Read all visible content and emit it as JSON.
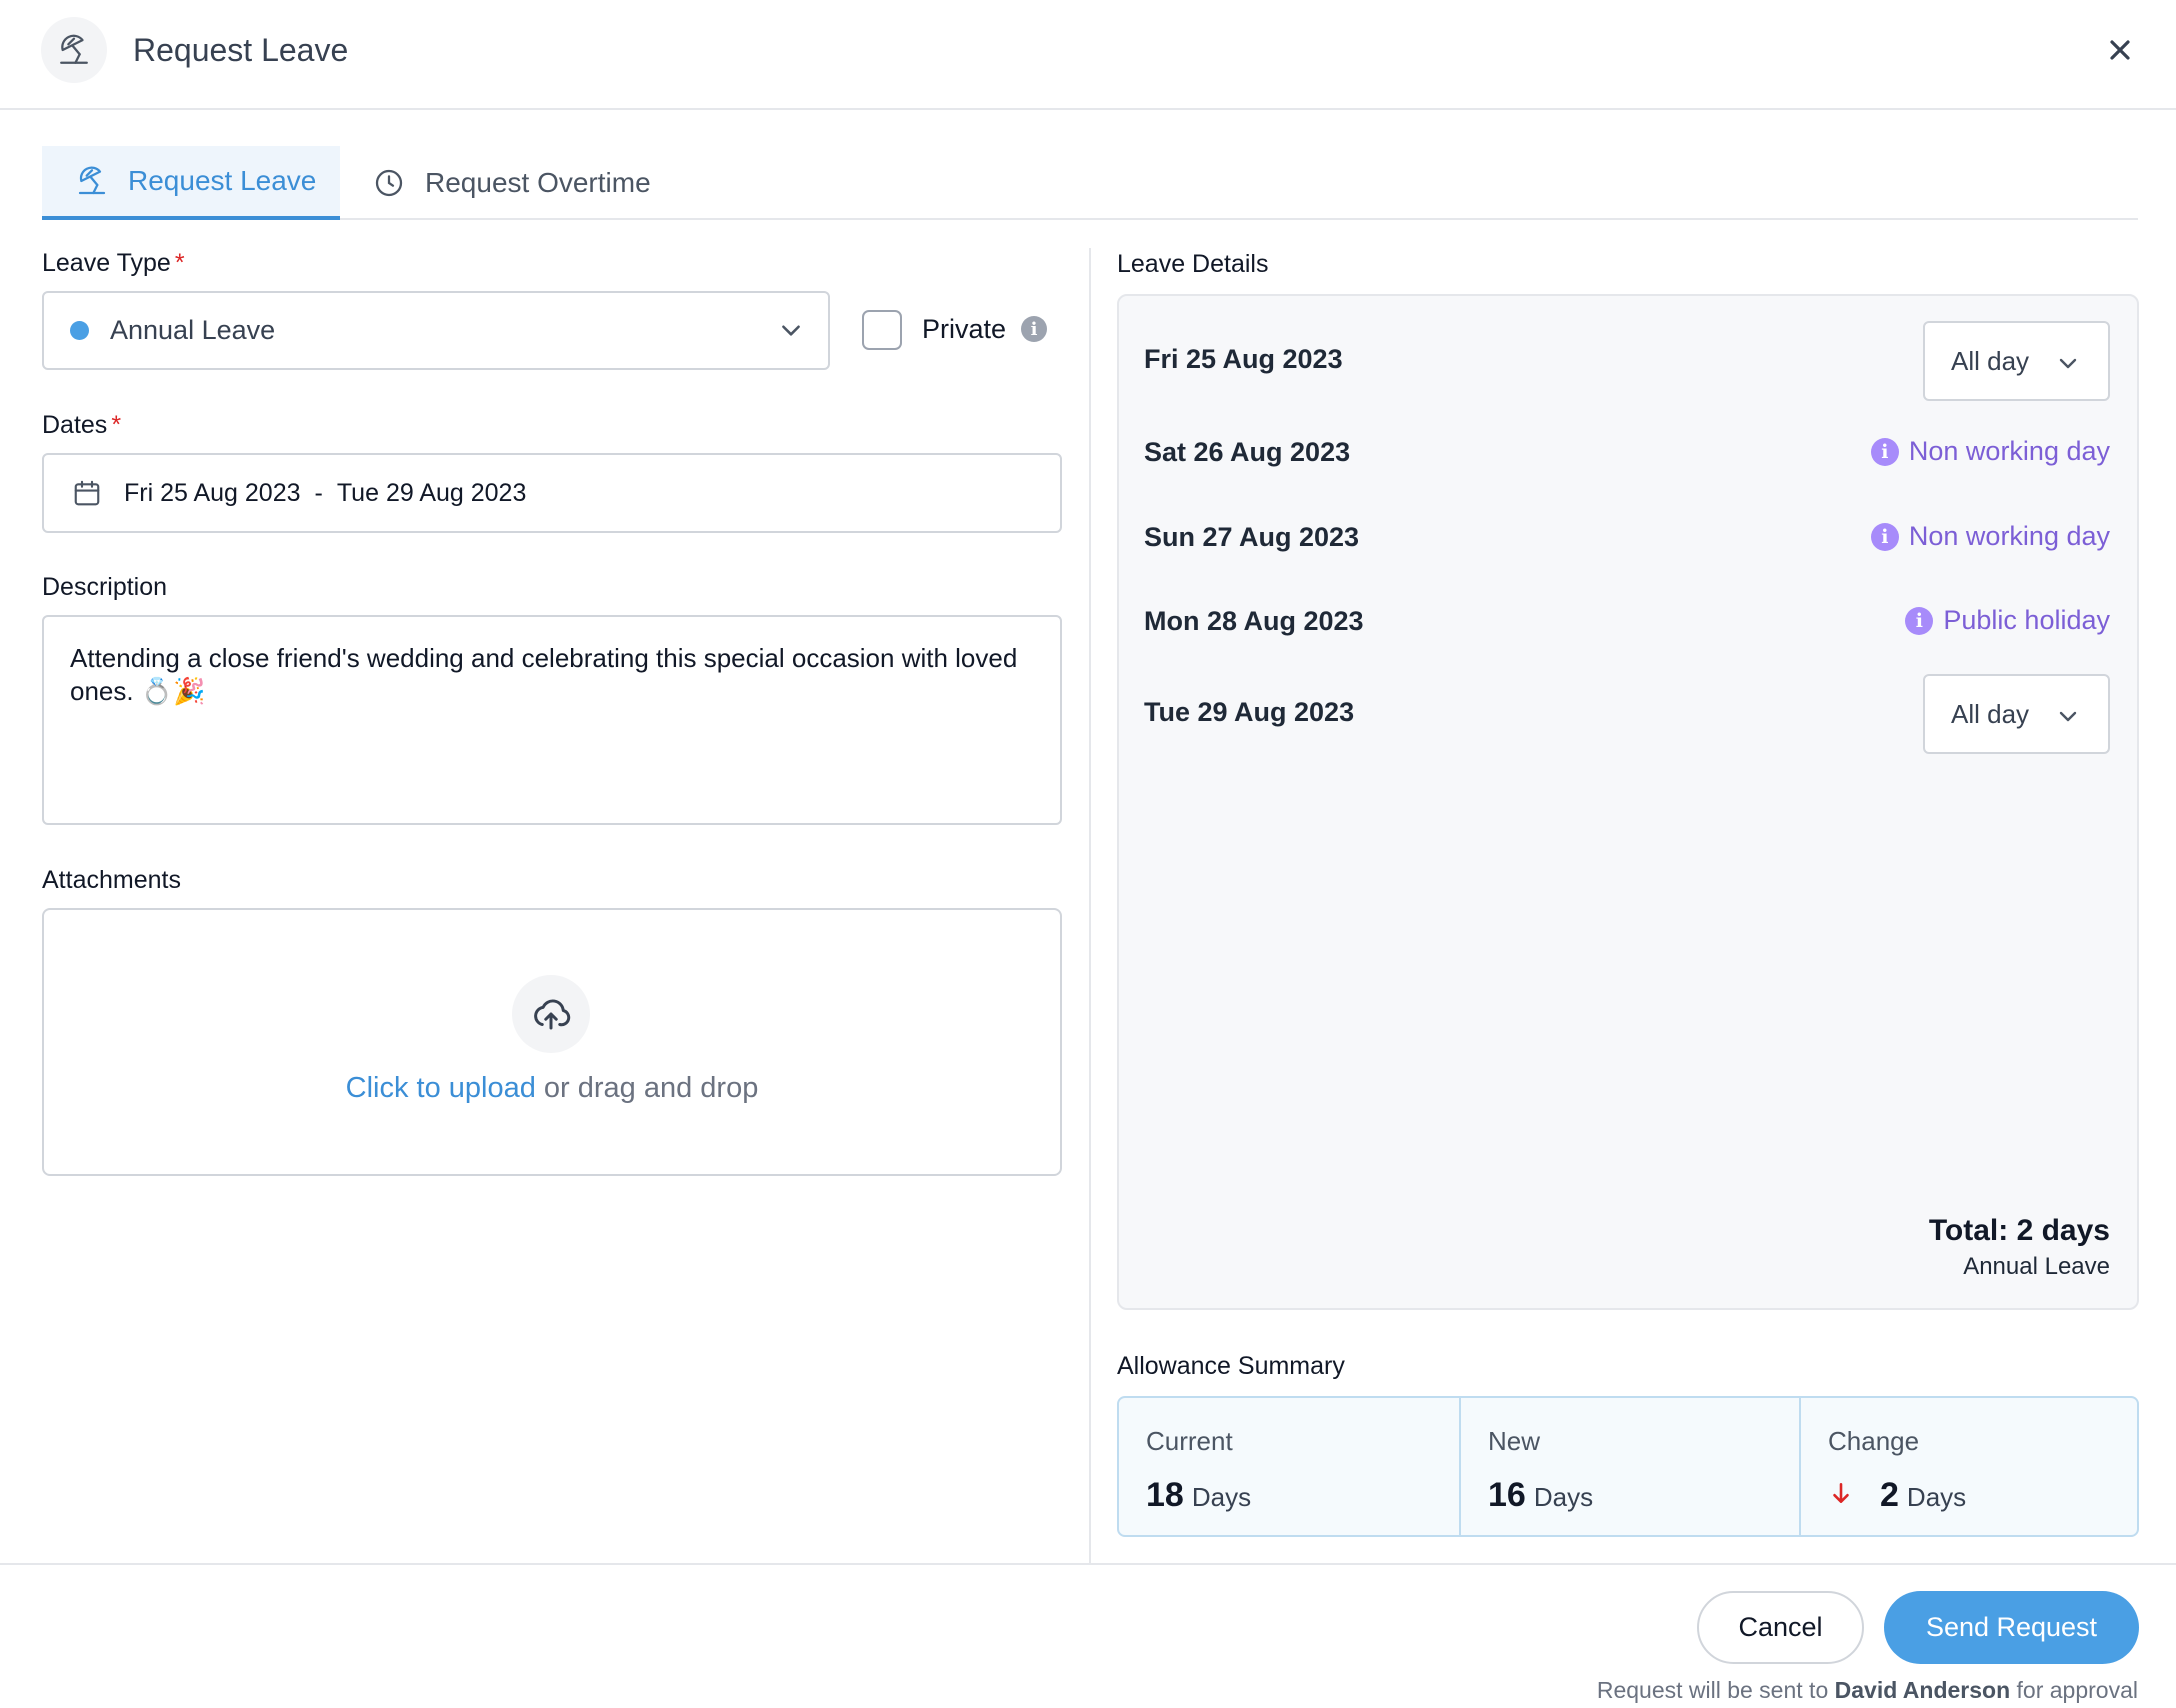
{
  "header": {
    "title": "Request Leave",
    "icon": "umbrella-icon",
    "close_icon": "close-icon"
  },
  "tabs": [
    {
      "label": "Request Leave",
      "icon": "umbrella-icon",
      "active": true
    },
    {
      "label": "Request Overtime",
      "icon": "clock-icon",
      "active": false
    }
  ],
  "form": {
    "leave_type": {
      "label": "Leave Type",
      "required_mark": "*",
      "value": "Annual Leave",
      "dot_color": "#4a9fe4"
    },
    "private": {
      "label": "Private",
      "checked": false,
      "info_icon": "info-icon"
    },
    "dates": {
      "label": "Dates",
      "required_mark": "*",
      "start": "Fri 25 Aug 2023",
      "separator": "-",
      "end": "Tue 29 Aug 2023"
    },
    "description": {
      "label": "Description",
      "value": "Attending a close friend's wedding and celebrating this special occasion with loved ones. 💍🎉"
    },
    "attachments": {
      "label": "Attachments",
      "link_text": "Click to upload",
      "rest_text": "or drag and drop",
      "icon": "upload-cloud-icon"
    }
  },
  "leave_details": {
    "title": "Leave Details",
    "days": [
      {
        "date": "Fri 25 Aug 2023",
        "type": "select",
        "value": "All day"
      },
      {
        "date": "Sat 26 Aug 2023",
        "type": "status",
        "value": "Non working day"
      },
      {
        "date": "Sun 27 Aug 2023",
        "type": "status",
        "value": "Non working day"
      },
      {
        "date": "Mon 28 Aug 2023",
        "type": "status",
        "value": "Public holiday"
      },
      {
        "date": "Tue 29 Aug 2023",
        "type": "select",
        "value": "All day"
      }
    ],
    "total": "Total: 2 days",
    "total_sub": "Annual Leave"
  },
  "allowance": {
    "title": "Allowance Summary",
    "current": {
      "label": "Current",
      "value": "18",
      "unit": "Days"
    },
    "new": {
      "label": "New",
      "value": "16",
      "unit": "Days"
    },
    "change": {
      "label": "Change",
      "value": "2",
      "unit": "Days",
      "direction": "down"
    }
  },
  "footer": {
    "cancel": "Cancel",
    "send": "Send Request",
    "note_prefix": "Request will be sent to",
    "approver": "David Anderson",
    "note_suffix": "for approval"
  },
  "colors": {
    "accent": "#3b8ed6",
    "primary_button": "#4a9fe4",
    "status_purple": "#7c5fd6",
    "required": "#dc2626"
  }
}
